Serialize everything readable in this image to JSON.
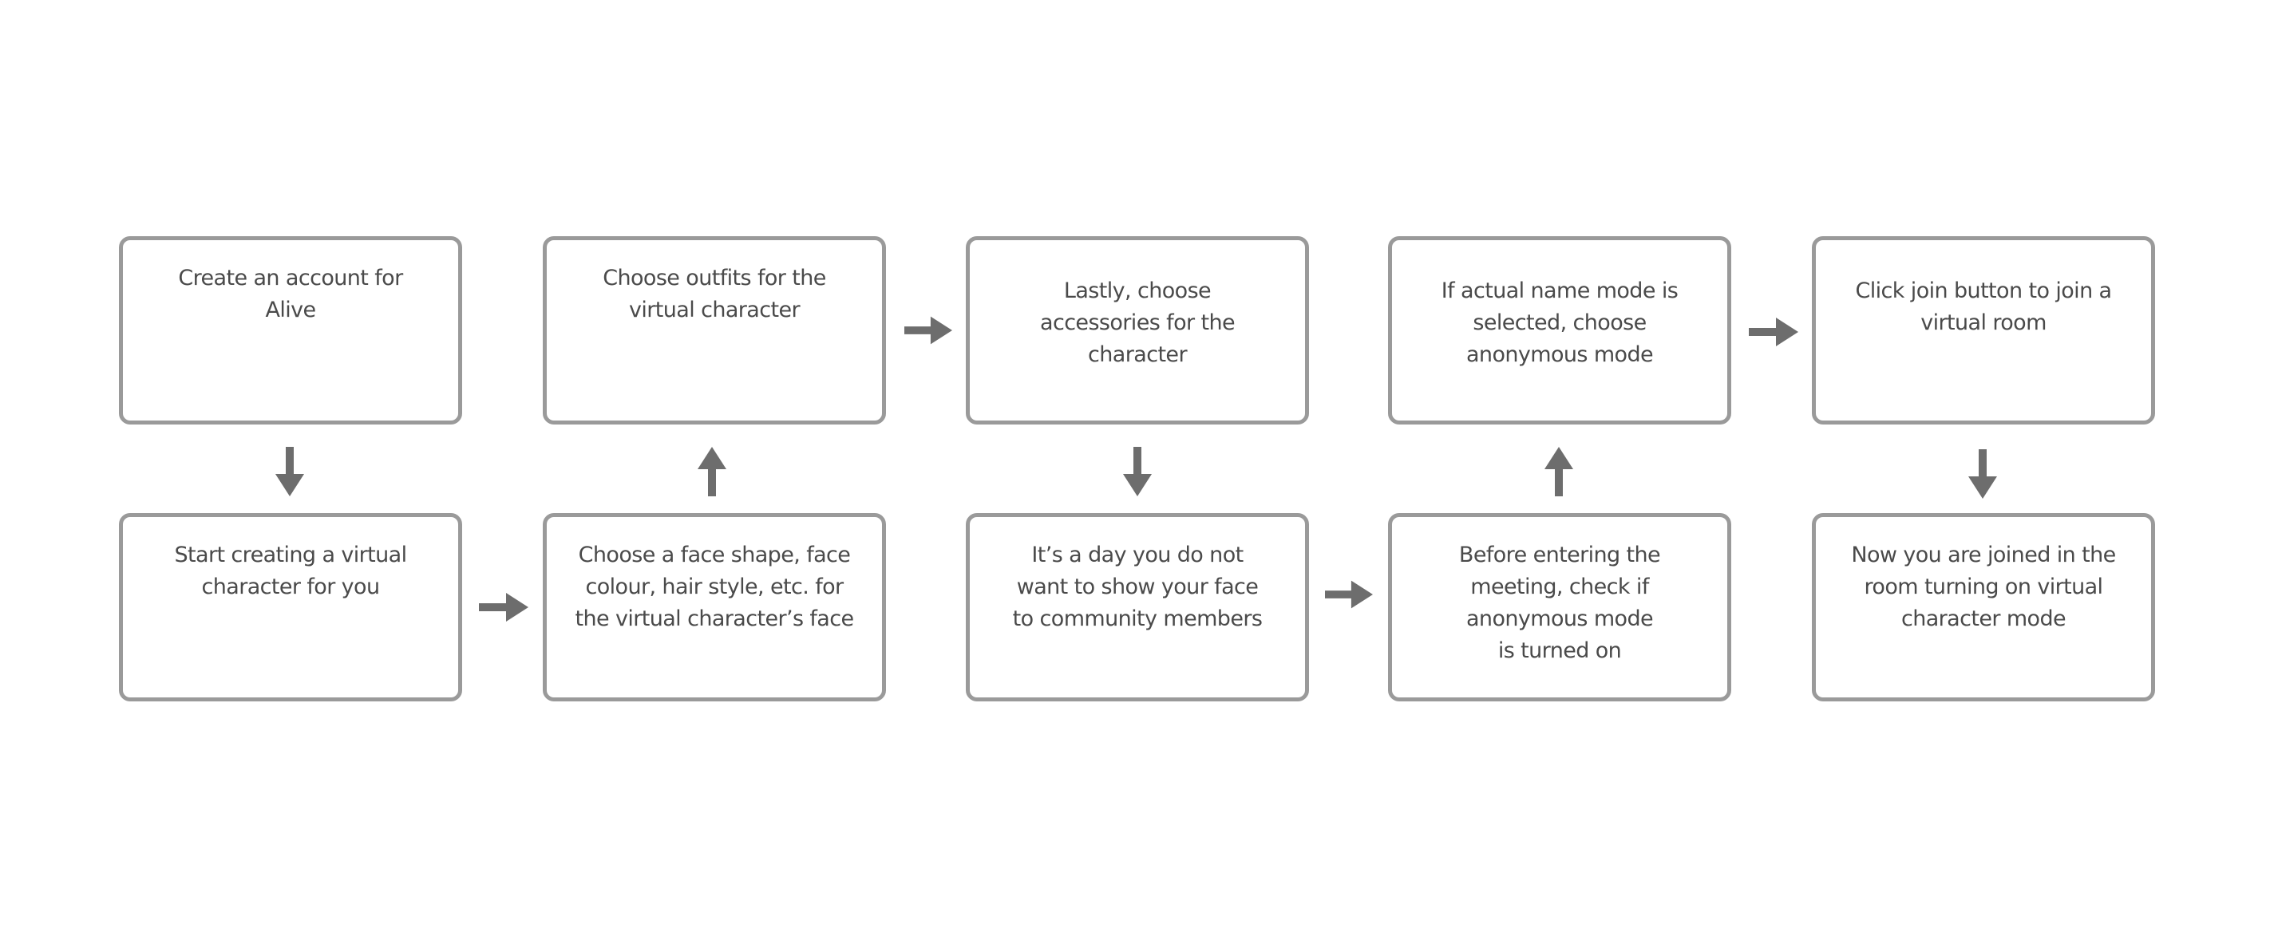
{
  "colors": {
    "box_border": "#9a9a9a",
    "arrow": "#6d6d6d",
    "text": "#4a4a4a"
  },
  "steps": [
    {
      "text": "Create an account for Alive"
    },
    {
      "text": "Start creating a virtual character for you"
    },
    {
      "text": "Choose a face shape, face colour, hair style, etc. for the virtual character’s face"
    },
    {
      "text": "Choose outfits for the virtual character"
    },
    {
      "text": "Lastly, choose accessories for the character"
    },
    {
      "text": "It’s a day you do not want to show your face to community members"
    },
    {
      "text": "Before entering the meeting, check if anonymous mode is turned on"
    },
    {
      "text": "If actual name mode is selected, choose anonymous mode"
    },
    {
      "text": "Click join button to join a virtual room"
    },
    {
      "text": "Now you are joined  in the room turning on virtual character mode"
    }
  ]
}
